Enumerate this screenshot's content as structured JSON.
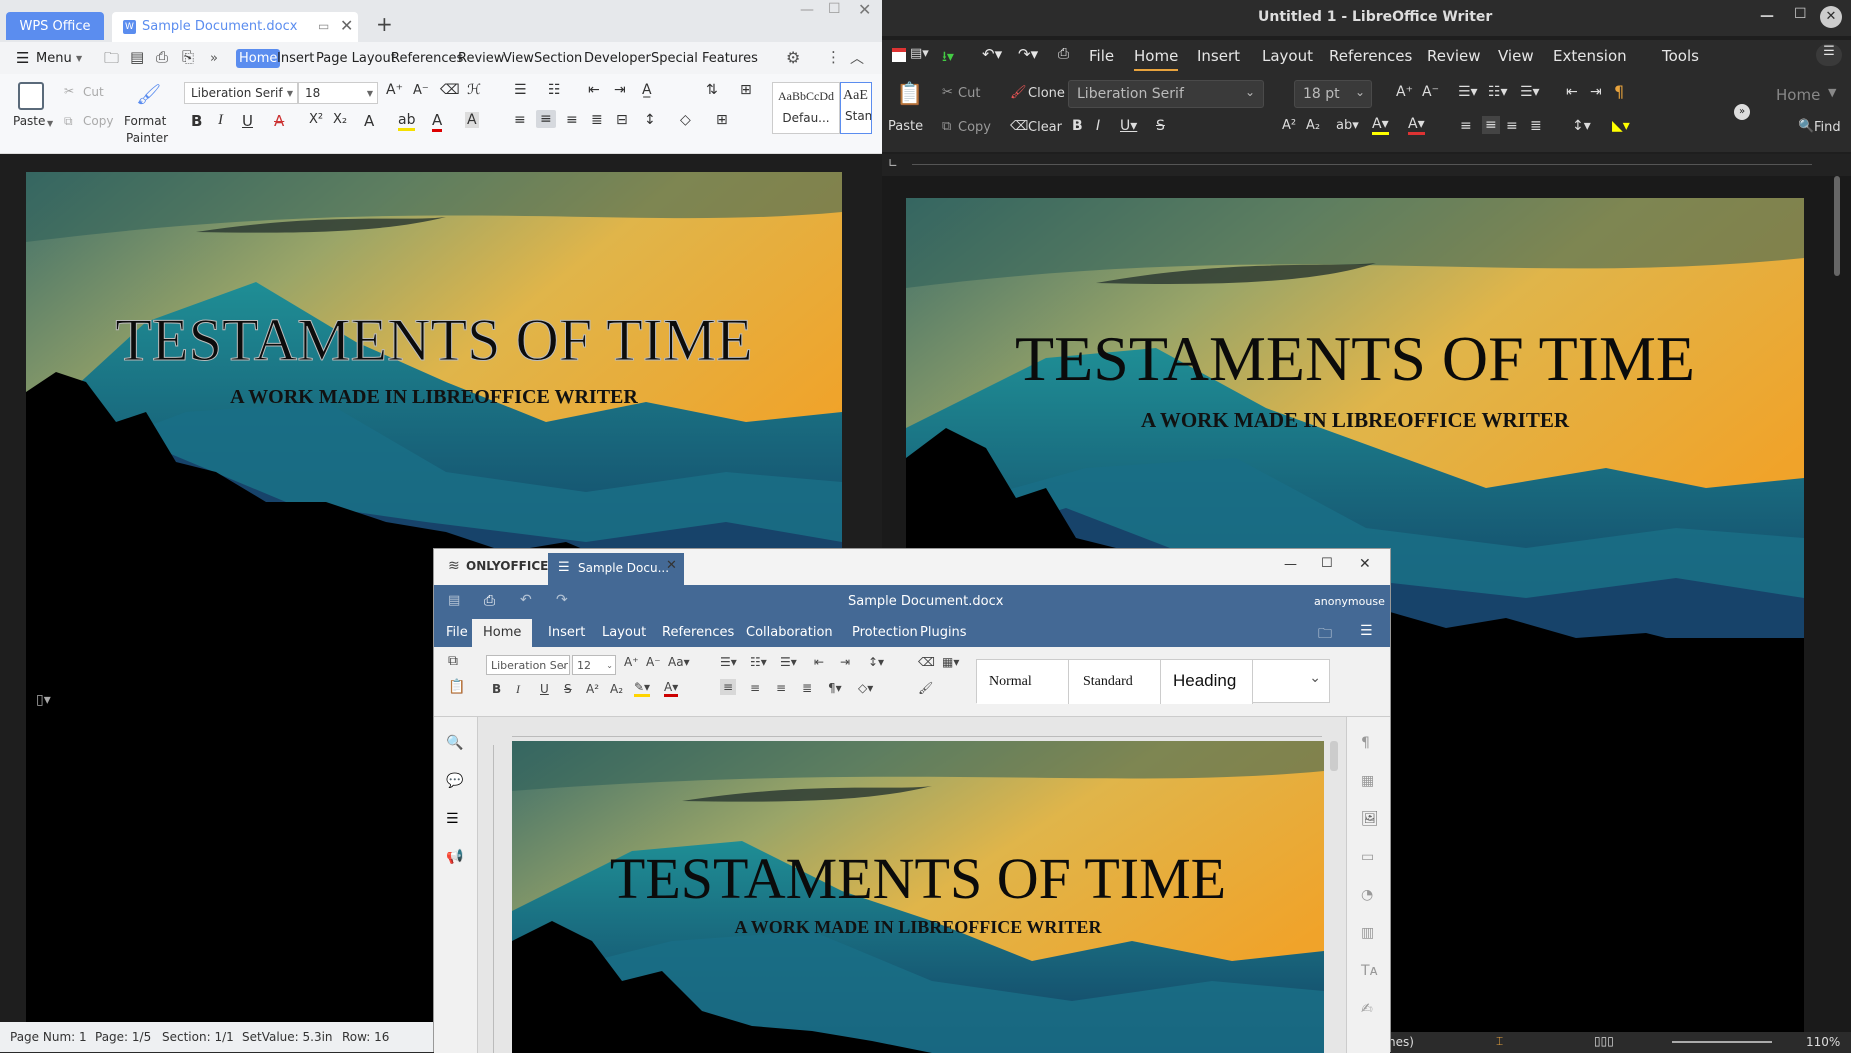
{
  "wps": {
    "brand_tab": "WPS Office",
    "doc_tab": "Sample Document.docx",
    "menu": {
      "menu_label": "Menu",
      "tabs": [
        "Home",
        "Insert",
        "Page Layout",
        "References",
        "Review",
        "View",
        "Section",
        "Developer",
        "Special Features"
      ]
    },
    "ribbon": {
      "paste": "Paste",
      "cut": "Cut",
      "copy": "Copy",
      "format_painter_1": "Format",
      "format_painter_2": "Painter",
      "font_name": "Liberation Serif",
      "font_size": "18",
      "style_preview": "AaBbCcDd",
      "style_default": "Defau...",
      "style_preview2": "AaE",
      "style_standard": "Stan"
    },
    "document": {
      "title": "TESTAMENTS OF TIME",
      "subtitle": "A WORK MADE IN LIBREOFFICE WRITER"
    },
    "status": {
      "page_num": "Page Num: 1",
      "page": "Page: 1/5",
      "section": "Section: 1/1",
      "set_value": "SetValue: 5.3in",
      "row": "Row: 16"
    }
  },
  "libreoffice": {
    "window_title": "Untitled 1 - LibreOffice Writer",
    "menu": [
      "File",
      "Home",
      "Insert",
      "Layout",
      "References",
      "Review",
      "View",
      "Extension",
      "Tools"
    ],
    "clone": "Clone",
    "clear": "Clear",
    "cut": "Cut",
    "copy": "Copy",
    "paste": "Paste",
    "font_name": "Liberation Serif",
    "font_size": "18 pt",
    "home_dropdown": "Home",
    "find": "Find",
    "document": {
      "title": "TESTAMENTS OF TIME",
      "subtitle": "A WORK MADE IN LIBREOFFICE WRITER"
    },
    "status": {
      "lines": "nes)",
      "zoom": "110%"
    }
  },
  "onlyoffice": {
    "brand": "ONLYOFFICE",
    "tab": "Sample Docu...",
    "doc_title": "Sample Document.docx",
    "user": "anonymouse",
    "tabs": [
      "File",
      "Home",
      "Insert",
      "Layout",
      "References",
      "Collaboration",
      "Protection",
      "Plugins"
    ],
    "font_name": "Liberation Ser",
    "font_size": "12",
    "styles": [
      "Normal",
      "Standard",
      "Heading"
    ],
    "document": {
      "title": "TESTAMENTS OF TIME",
      "subtitle": "A WORK MADE IN LIBREOFFICE WRITER"
    }
  },
  "colors": {
    "wps_accent": "#5b8def",
    "onlyoffice_header": "#446995",
    "lo_dark": "#2b2b2b",
    "lo_accent": "#e8a33d"
  }
}
